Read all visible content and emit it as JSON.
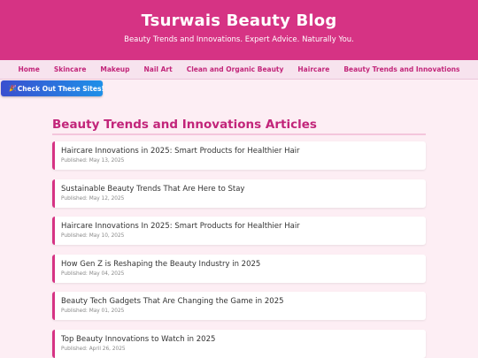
{
  "header": {
    "title": "Tsurwais Beauty Blog",
    "tagline": "Beauty Trends and Innovations. Expert Advice. Naturally You."
  },
  "nav": {
    "items": [
      {
        "label": "Home"
      },
      {
        "label": "Skincare"
      },
      {
        "label": "Makeup"
      },
      {
        "label": "Nail Art"
      },
      {
        "label": "Clean and Organic Beauty"
      },
      {
        "label": "Haircare"
      },
      {
        "label": "Beauty Trends and Innovations"
      }
    ]
  },
  "promo": {
    "label": "Check Out These Sites!",
    "icon": "party-popper-icon"
  },
  "section": {
    "title": "Beauty Trends and Innovations Articles"
  },
  "articles": [
    {
      "title": "Haircare Innovations in 2025: Smart Products for Healthier Hair",
      "date": "Published: May 13, 2025"
    },
    {
      "title": "Sustainable Beauty Trends That Are Here to Stay",
      "date": "Published: May 12, 2025"
    },
    {
      "title": "Haircare Innovations In 2025: Smart Products for Healthier Hair",
      "date": "Published: May 10, 2025"
    },
    {
      "title": "How Gen Z is Reshaping the Beauty Industry in 2025",
      "date": "Published: May 04, 2025"
    },
    {
      "title": "Beauty Tech Gadgets That Are Changing the Game in 2025",
      "date": "Published: May 01, 2025"
    },
    {
      "title": "Top Beauty Innovations to Watch in 2025",
      "date": "Published: April 26, 2025"
    }
  ],
  "colors": {
    "brand": "#d63384",
    "nav_text": "#c2257a",
    "page_bg": "#fdeef4",
    "promo_start": "#3a4fcf",
    "promo_end": "#1e90e8"
  }
}
